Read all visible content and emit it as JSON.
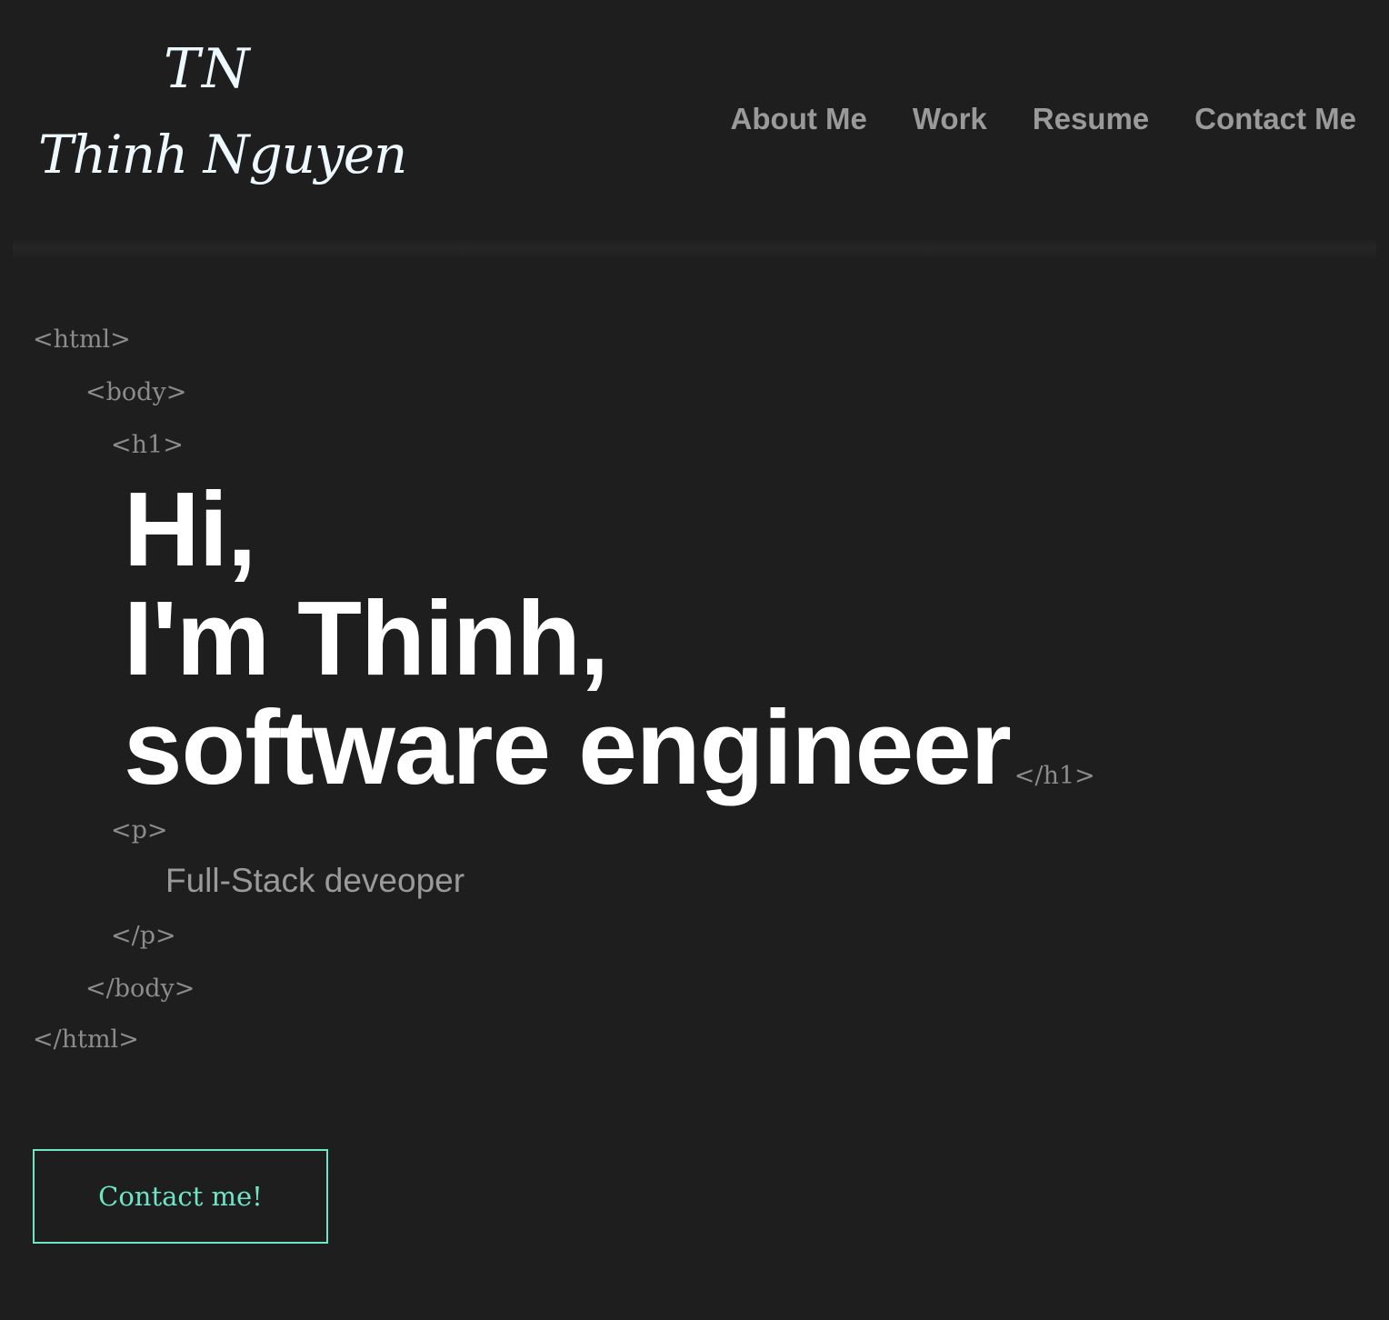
{
  "header": {
    "logo": {
      "initials": "TN",
      "name": "Thinh Nguyen"
    },
    "nav": [
      {
        "label": "About Me"
      },
      {
        "label": "Work"
      },
      {
        "label": "Resume"
      },
      {
        "label": "Contact Me"
      }
    ]
  },
  "code_tags": {
    "html_open": "<html>",
    "body_open": "<body>",
    "h1_open": "<h1>",
    "h1_close": "</h1>",
    "p_open": "<p>",
    "p_close": "</p>",
    "body_close": "</body>",
    "html_close": "</html>"
  },
  "hero": {
    "line1": "Hi,",
    "line2": "I'm Thinh,",
    "line3": "software engineer"
  },
  "subtitle": "Full-Stack deveoper",
  "cta": {
    "label": "Contact me!"
  },
  "colors": {
    "background": "#1e1e1e",
    "accent": "#6ee6c6",
    "muted_text": "#9a9a9a",
    "tag_text": "#8c8c8c"
  }
}
